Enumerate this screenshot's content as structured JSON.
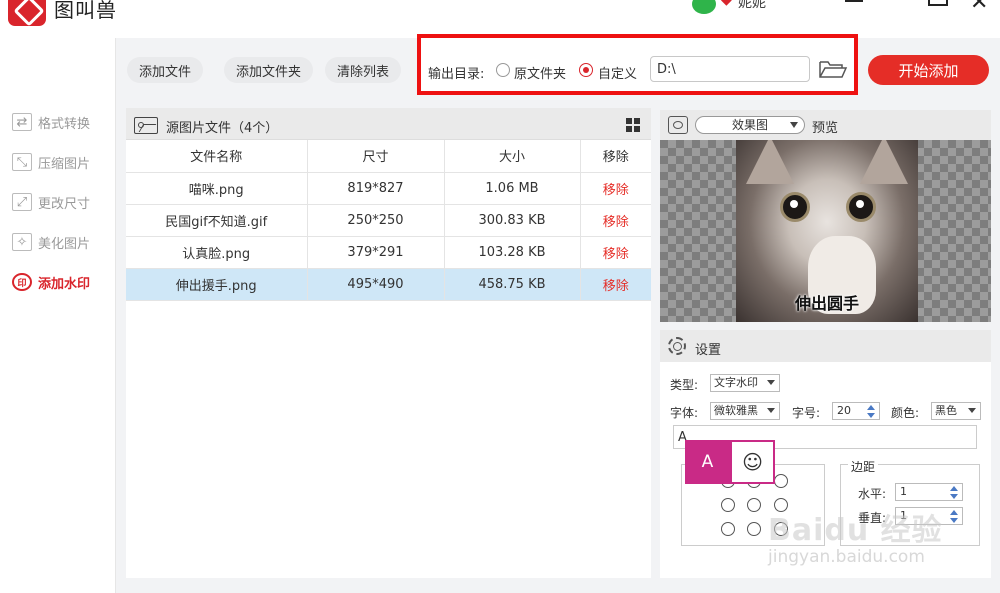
{
  "app": {
    "title": "图叫兽"
  },
  "user": {
    "name": "妮妮"
  },
  "sidebar": {
    "items": [
      {
        "label": "格式转换",
        "icon": "swap-icon"
      },
      {
        "label": "压缩图片",
        "icon": "compress-icon"
      },
      {
        "label": "更改尺寸",
        "icon": "resize-icon"
      },
      {
        "label": "美化图片",
        "icon": "beautify-icon"
      },
      {
        "label": "添加水印",
        "icon": "stamp-icon",
        "icon_text": "印",
        "active": true
      }
    ]
  },
  "toolbar": {
    "add_file": "添加文件",
    "add_folder": "添加文件夹",
    "clear_list": "清除列表",
    "output_label": "输出目录:",
    "radio_source": "原文件夹",
    "radio_custom": "自定义",
    "selected_radio": "自定义",
    "output_path": "D:\\",
    "start_button": "开始添加"
  },
  "file_list": {
    "title": "源图片文件（4个）",
    "columns": [
      "文件名称",
      "尺寸",
      "大小",
      "移除"
    ],
    "rows": [
      {
        "name": "喵咪.png",
        "size": "819*827",
        "filesize": "1.06 MB",
        "remove": "移除"
      },
      {
        "name": "民国gif不知道.gif",
        "size": "250*250",
        "filesize": "300.83 KB",
        "remove": "移除"
      },
      {
        "name": "认真脸.png",
        "size": "379*291",
        "filesize": "103.28 KB",
        "remove": "移除"
      },
      {
        "name": "伸出援手.png",
        "size": "495*490",
        "filesize": "458.75 KB",
        "remove": "移除",
        "selected": true
      }
    ]
  },
  "preview": {
    "mode": "效果图",
    "label": "预览",
    "caption": "伸出圆手"
  },
  "settings": {
    "title": "设置",
    "type_label": "类型:",
    "type_value": "文字水印",
    "font_label": "字体:",
    "font_value": "微软雅黑",
    "size_label": "字号:",
    "size_value": "20",
    "color_label": "颜色:",
    "color_value": "黑色",
    "text_value": "A",
    "margin_title": "边距",
    "horizontal_label": "水平:",
    "horizontal_value": "1",
    "vertical_label": "垂直:",
    "vertical_value": "1",
    "popup_text": "A",
    "popup_emoji": "☺"
  },
  "overlay": {
    "watermark": "Baidu 经验",
    "watermark_url": "jingyan.baidu.com"
  },
  "colors": {
    "accent": "#e52d27",
    "highlight_box": "#ee1111",
    "selected_row": "#cfe7f7",
    "popup": "#c92a86"
  }
}
